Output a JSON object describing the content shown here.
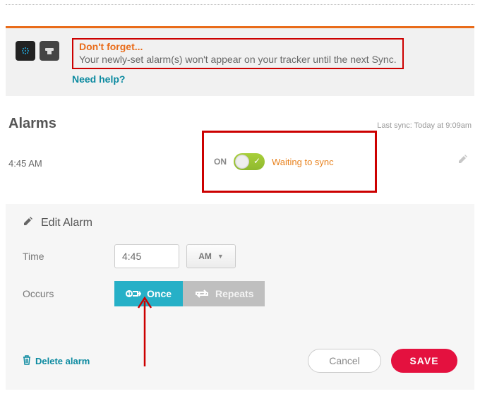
{
  "banner": {
    "title": "Don't forget...",
    "text": "Your newly-set alarm(s) won't appear on your tracker until the next Sync.",
    "help": "Need help?"
  },
  "alarms": {
    "heading": "Alarms",
    "last_sync": "Last sync: Today at 9:09am",
    "row": {
      "time": "4:45 AM",
      "state_label": "ON",
      "status": "Waiting to sync"
    }
  },
  "edit": {
    "title": "Edit Alarm",
    "time_label": "Time",
    "time_value": "4:45",
    "ampm": "AM",
    "occurs_label": "Occurs",
    "once": "Once",
    "repeats": "Repeats",
    "delete": "Delete alarm",
    "cancel": "Cancel",
    "save": "SAVE"
  },
  "colors": {
    "accent_orange": "#e96c1a",
    "accent_teal": "#26b0c7",
    "accent_link": "#0c8aa0",
    "accent_red": "#e4113f",
    "callout_border": "#cc0000"
  }
}
